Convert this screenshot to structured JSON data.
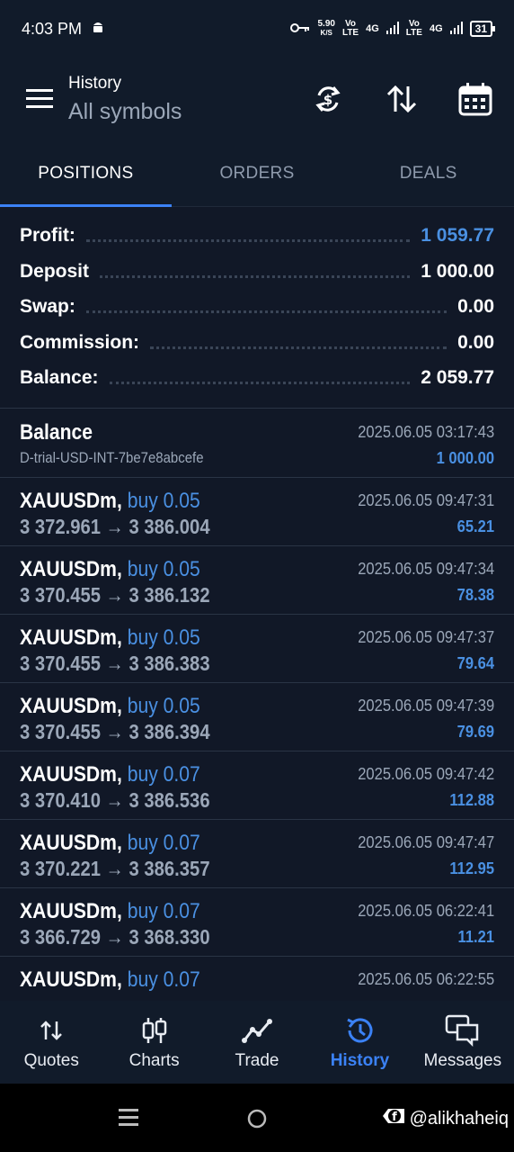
{
  "status": {
    "time": "4:03 PM",
    "speed_top": "5.90",
    "speed_unit": "K/S",
    "vo1_top": "Vo",
    "vo1_bot": "LTE",
    "net1": "4G",
    "vo2_top": "Vo",
    "vo2_bot": "LTE",
    "net2": "4G",
    "battery": "31"
  },
  "header": {
    "subtitle": "History",
    "title": "All symbols"
  },
  "tabs": [
    {
      "label": "POSITIONS",
      "active": true
    },
    {
      "label": "ORDERS",
      "active": false
    },
    {
      "label": "DEALS",
      "active": false
    }
  ],
  "summary": {
    "profit_label": "Profit:",
    "profit_value": "1 059.77",
    "deposit_label": "Deposit",
    "deposit_value": "1 000.00",
    "swap_label": "Swap:",
    "swap_value": "0.00",
    "commission_label": "Commission:",
    "commission_value": "0.00",
    "balance_label": "Balance:",
    "balance_value": "2 059.77"
  },
  "balance_entry": {
    "title": "Balance",
    "account": "D-trial-USD-INT-7be7e8abcefe",
    "time": "2025.06.05 03:17:43",
    "amount": "1 000.00"
  },
  "positions": [
    {
      "symbol": "XAUUSDm,",
      "type": "buy 0.05",
      "prices": "3 372.961 → 3 386.004",
      "time": "2025.06.05 09:47:31",
      "profit": "65.21"
    },
    {
      "symbol": "XAUUSDm,",
      "type": "buy 0.05",
      "prices": "3 370.455 → 3 386.132",
      "time": "2025.06.05 09:47:34",
      "profit": "78.38"
    },
    {
      "symbol": "XAUUSDm,",
      "type": "buy 0.05",
      "prices": "3 370.455 → 3 386.383",
      "time": "2025.06.05 09:47:37",
      "profit": "79.64"
    },
    {
      "symbol": "XAUUSDm,",
      "type": "buy 0.05",
      "prices": "3 370.455 → 3 386.394",
      "time": "2025.06.05 09:47:39",
      "profit": "79.69"
    },
    {
      "symbol": "XAUUSDm,",
      "type": "buy 0.07",
      "prices": "3 370.410 → 3 386.536",
      "time": "2025.06.05 09:47:42",
      "profit": "112.88"
    },
    {
      "symbol": "XAUUSDm,",
      "type": "buy 0.07",
      "prices": "3 370.221 → 3 386.357",
      "time": "2025.06.05 09:47:47",
      "profit": "112.95"
    },
    {
      "symbol": "XAUUSDm,",
      "type": "buy 0.07",
      "prices": "3 366.729 → 3 368.330",
      "time": "2025.06.05 06:22:41",
      "profit": "11.21"
    },
    {
      "symbol": "XAUUSDm,",
      "type": "buy 0.07",
      "prices": "",
      "time": "2025.06.05 06:22:55",
      "profit": ""
    }
  ],
  "nav": [
    {
      "label": "Quotes",
      "icon": "quotes-icon",
      "active": false
    },
    {
      "label": "Charts",
      "icon": "charts-icon",
      "active": false
    },
    {
      "label": "Trade",
      "icon": "trade-icon",
      "active": false
    },
    {
      "label": "History",
      "icon": "history-icon",
      "active": true
    },
    {
      "label": "Messages",
      "icon": "messages-icon",
      "active": false
    }
  ],
  "watermark": "@alikhaheiq",
  "colors": {
    "accent": "#3b82f6",
    "profit_blue": "#4a90e2",
    "background": "#111827"
  }
}
